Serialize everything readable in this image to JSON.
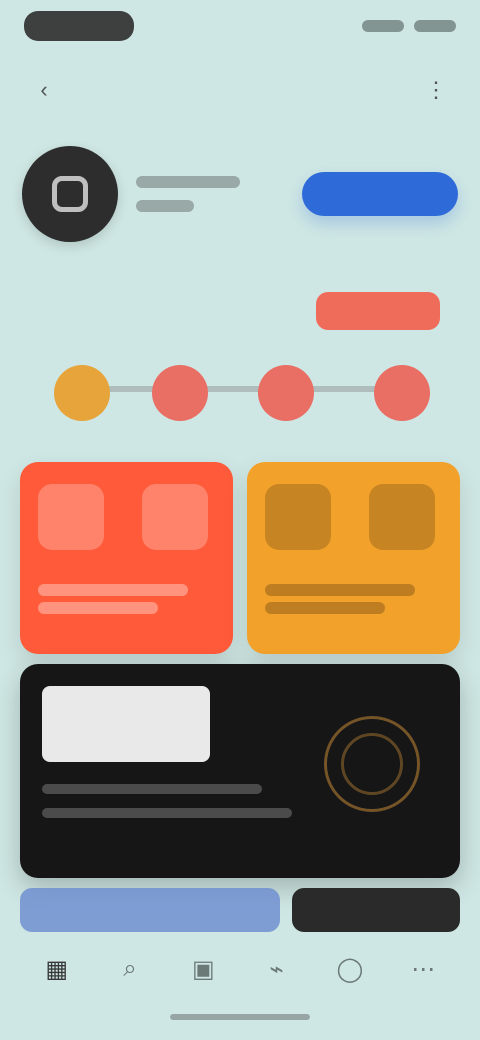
{
  "status": {
    "left_pill": "",
    "right": [
      "",
      ""
    ]
  },
  "topbar": {
    "title": "",
    "left_icon": "back-icon",
    "right_icon": "menu-icon"
  },
  "profile": {
    "name": "",
    "meta": "",
    "follow_button": ""
  },
  "section": {
    "title": "",
    "chip_label": ""
  },
  "steps": {
    "labels": [
      "",
      "",
      ""
    ]
  },
  "cards": [
    {
      "tile_1": "",
      "tile_2": ""
    },
    {
      "tile_1": "",
      "tile_2": ""
    }
  ],
  "promo": {
    "headline": ""
  },
  "cta": {
    "left_label": "",
    "right_label": ""
  },
  "bottom_nav": {
    "items": [
      {
        "icon": "home-icon"
      },
      {
        "icon": "search-icon"
      },
      {
        "icon": "grid-icon"
      },
      {
        "icon": "bell-icon"
      },
      {
        "icon": "profile-icon"
      },
      {
        "icon": "more-icon"
      }
    ]
  },
  "colors": {
    "background": "#cfe7e4",
    "primary_blue": "#2f6ad9",
    "card_red": "#ff5a3a",
    "card_amber": "#f2a12a",
    "promo_black": "#161616",
    "chip_red": "#f06c5a"
  }
}
